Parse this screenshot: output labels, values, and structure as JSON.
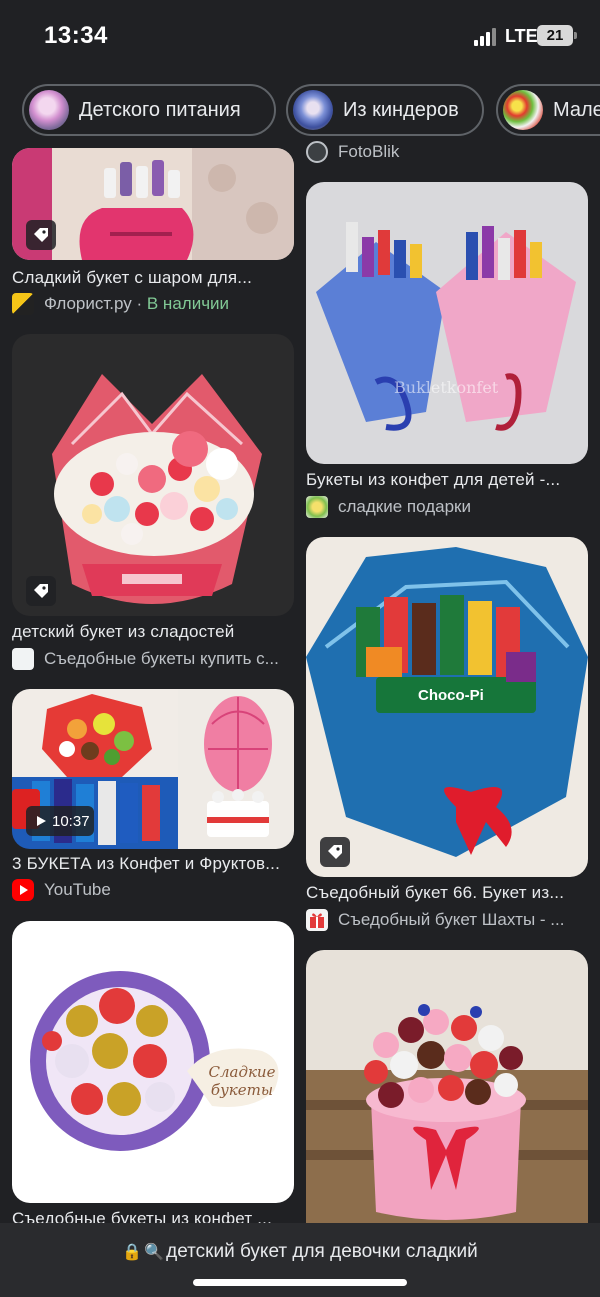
{
  "status": {
    "time": "13:34",
    "network": "LTE",
    "battery": "21"
  },
  "chips": [
    {
      "label": "Детского питания",
      "icon": "bouquet-thumbnail"
    },
    {
      "label": "Из киндеров",
      "icon": "kinder-bouquet-thumbnail"
    },
    {
      "label": "Мале",
      "icon": "fruit-bouquet-thumbnail"
    }
  ],
  "left_column": [
    {
      "title": "Сладкий букет с шаром для...",
      "source": "Флорист.ру",
      "separator": " · ",
      "availability": "В наличии",
      "tag": "shopping-tag-icon"
    },
    {
      "title": "детский букет из сладостей",
      "source": "Съедобные букеты купить с...",
      "tag": "shopping-tag-icon"
    },
    {
      "title": "3 БУКЕТА из Конфет и Фруктов...",
      "source": "YouTube",
      "duration": "10:37"
    },
    {
      "title": "Съедобные букеты из конфет ...",
      "image_caption": "Сладкие букеты"
    }
  ],
  "right_column": [
    {
      "source": "FotoBlik"
    },
    {
      "title": "Букеты из конфет для детей -...",
      "source": "сладкие подарки",
      "image_caption": "Bukletkonfet"
    },
    {
      "title": "Съедобный букет 66. Букет из...",
      "source": "Съедобный букет Шахты - ...",
      "tag": "shopping-tag-icon",
      "image_caption": "Choco-Pi"
    },
    {
      "title": ""
    }
  ],
  "address_bar": {
    "url": "детский букет для девочки сладкий",
    "lock_icon": "lock-icon",
    "search_icon": "search-icon"
  }
}
